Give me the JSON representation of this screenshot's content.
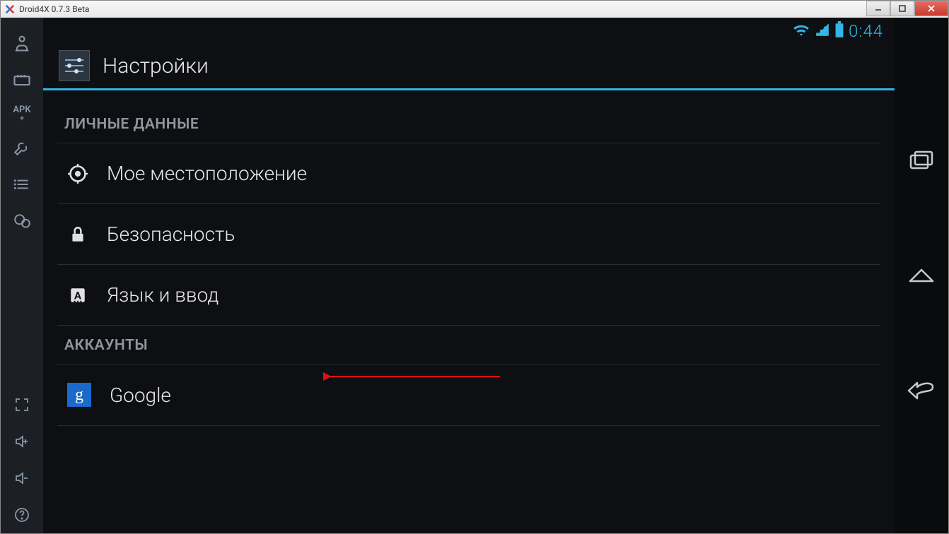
{
  "window": {
    "title": "Droid4X 0.7.3 Beta"
  },
  "leftRail": {
    "apkLabel": "APK"
  },
  "statusbar": {
    "clock": "0:44"
  },
  "header": {
    "title": "Настройки"
  },
  "sections": [
    {
      "header": "ЛИЧНЫЕ ДАННЫЕ",
      "items": [
        {
          "icon": "location",
          "label": "Мое местоположение"
        },
        {
          "icon": "lock",
          "label": "Безопасность"
        },
        {
          "icon": "language",
          "label": "Язык и ввод"
        }
      ]
    },
    {
      "header": "АККАУНТЫ",
      "items": [
        {
          "icon": "google",
          "label": "Google"
        }
      ]
    }
  ],
  "googleG": "g"
}
